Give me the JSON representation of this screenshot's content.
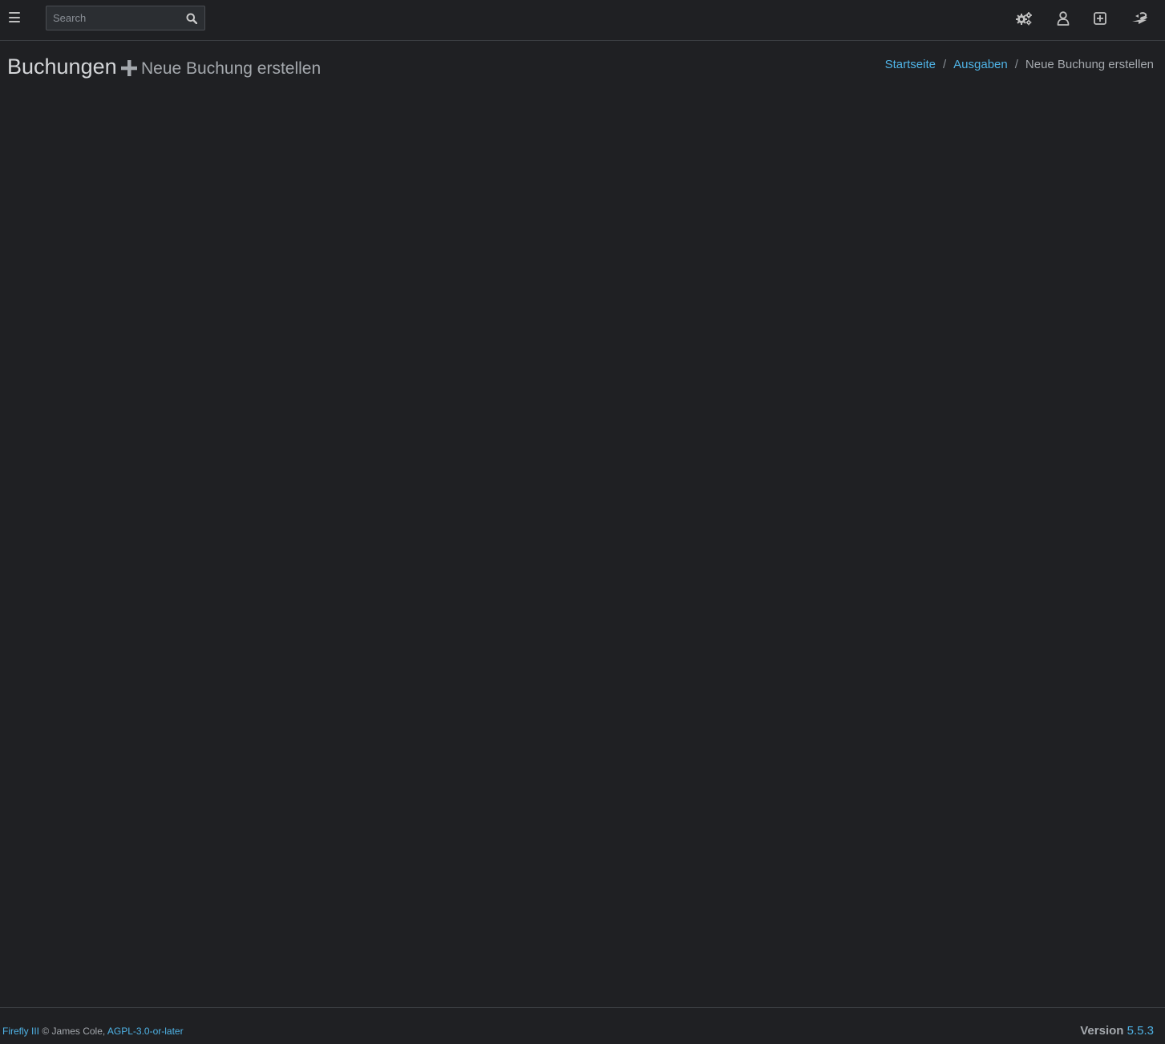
{
  "topbar": {
    "menu_icon": "bars-icon",
    "search": {
      "placeholder": "Search",
      "value": ""
    },
    "search_icon": "search-icon",
    "right_icons": [
      "gears-icon",
      "user-icon",
      "plus-square-icon",
      "logout-icon"
    ]
  },
  "header": {
    "title": "Buchungen",
    "title_icon": "plus-icon",
    "subtitle": "Neue Buchung erstellen"
  },
  "breadcrumb": {
    "items": [
      {
        "label": "Startseite",
        "link": true
      },
      {
        "label": "Ausgaben",
        "link": true
      },
      {
        "label": "Neue Buchung erstellen",
        "link": false
      }
    ],
    "separator": "/"
  },
  "footer": {
    "app_name": "Firefly III",
    "copyright": "© James Cole,",
    "license": "AGPL-3.0-or-later",
    "version_label": "Version",
    "version_number": "5.5.3"
  },
  "colors": {
    "background": "#1f2023",
    "link": "#4fb3e6",
    "text": "#c2c7d0"
  }
}
